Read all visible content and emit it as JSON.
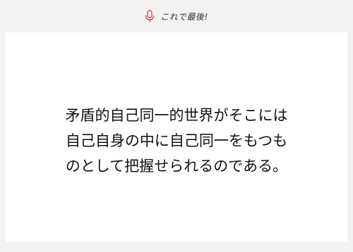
{
  "header": {
    "mic_icon": "microphone-icon",
    "mic_color": "#e0475c",
    "label": "これで最後!"
  },
  "card": {
    "lines": [
      "矛盾的自己同一的世界がそこには",
      "自己自身の中に自己同一をもつも",
      "のとして把握せられるのである。"
    ]
  }
}
